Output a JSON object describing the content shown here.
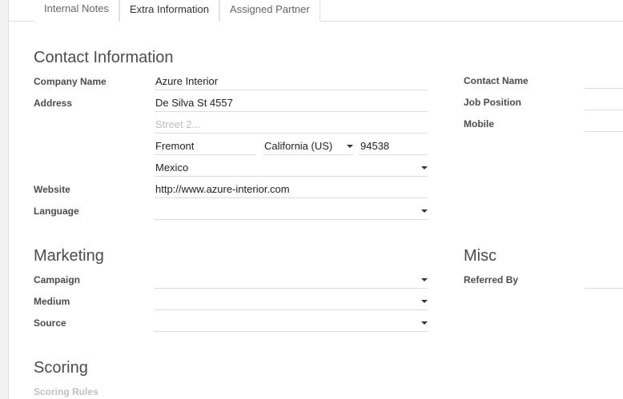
{
  "tabs": [
    {
      "label": "Internal Notes"
    },
    {
      "label": "Extra Information"
    },
    {
      "label": "Assigned Partner"
    }
  ],
  "contact": {
    "title": "Contact Information",
    "company_label": "Company Name",
    "company_value": "Azure Interior",
    "address_label": "Address",
    "street": "De Silva St 4557",
    "street2_placeholder": "Street 2...",
    "city": "Fremont",
    "state": "California (US)",
    "zip": "94538",
    "country": "Mexico",
    "website_label": "Website",
    "website_value": "http://www.azure-interior.com",
    "language_label": "Language",
    "language_value": "",
    "contact_name_label": "Contact Name",
    "job_position_label": "Job Position",
    "mobile_label": "Mobile"
  },
  "marketing": {
    "title": "Marketing",
    "campaign_label": "Campaign",
    "medium_label": "Medium",
    "source_label": "Source"
  },
  "misc": {
    "title": "Misc",
    "referred_by_label": "Referred By"
  },
  "scoring": {
    "title": "Scoring",
    "rules_label": "Scoring Rules"
  }
}
